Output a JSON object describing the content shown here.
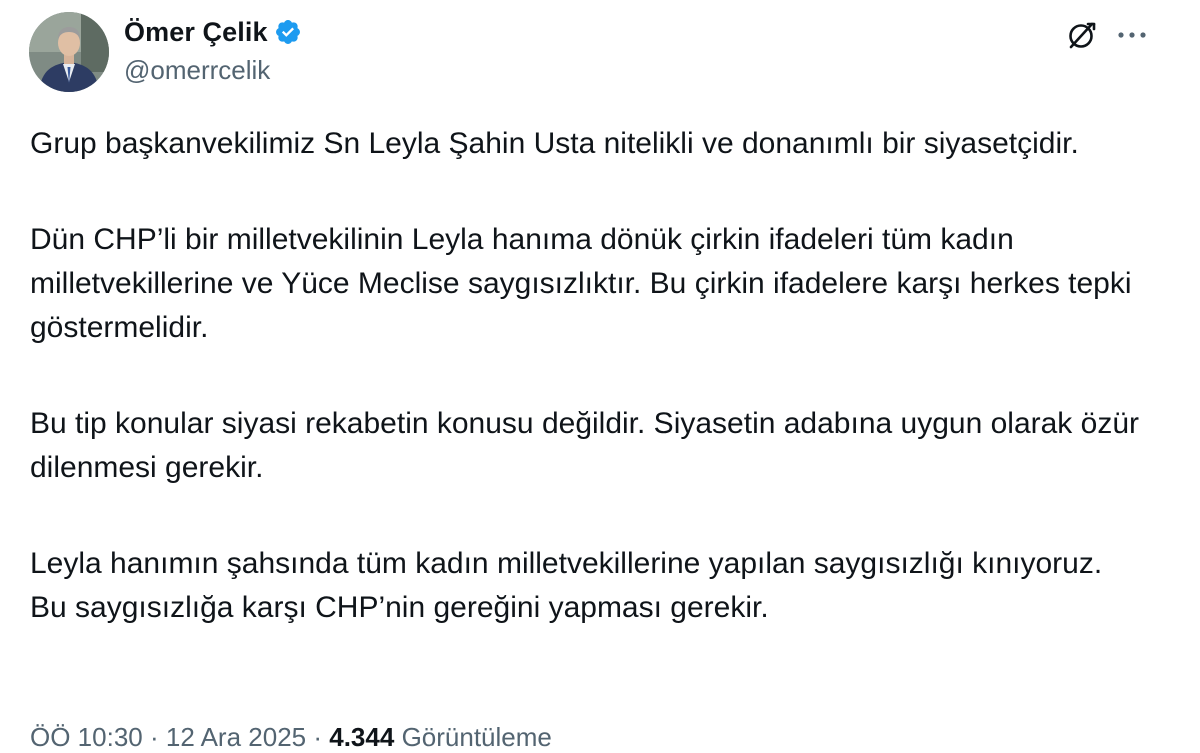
{
  "author": {
    "display_name": "Ömer Çelik",
    "handle": "@omerrcelik",
    "avatar_icon": "profile-photo",
    "verified_icon": "verified-badge-icon",
    "verified_color": "#1d9bf0"
  },
  "header_actions": {
    "grok_icon": "grok-icon",
    "more_icon": "more-options-icon"
  },
  "tweet": {
    "paragraphs": [
      "Grup başkanvekilimiz Sn Leyla Şahin Usta nitelikli ve donanımlı bir siyasetçidir.",
      "Dün CHP’li bir milletvekilinin Leyla hanıma dönük çirkin ifadeleri tüm kadın milletvekillerine ve Yüce Meclise saygısızlıktır. Bu çirkin ifadelere karşı herkes tepki göstermelidir.",
      "Bu tip konular siyasi rekabetin konusu değildir. Siyasetin adabına uygun olarak özür dilenmesi gerekir.",
      "Leyla hanımın şahsında tüm kadın milletvekillerine yapılan saygısızlığı kınıyoruz. Bu saygısızlığa karşı CHP’nin gereğini yapması gerekir."
    ]
  },
  "meta": {
    "time": "ÖÖ 10:30",
    "separator": "·",
    "date": "12 Ara 2025",
    "views_count": "4.344",
    "views_label": "Görüntüleme"
  },
  "colors": {
    "text_primary": "#0f1419",
    "text_secondary": "#536471",
    "accent": "#1d9bf0"
  }
}
